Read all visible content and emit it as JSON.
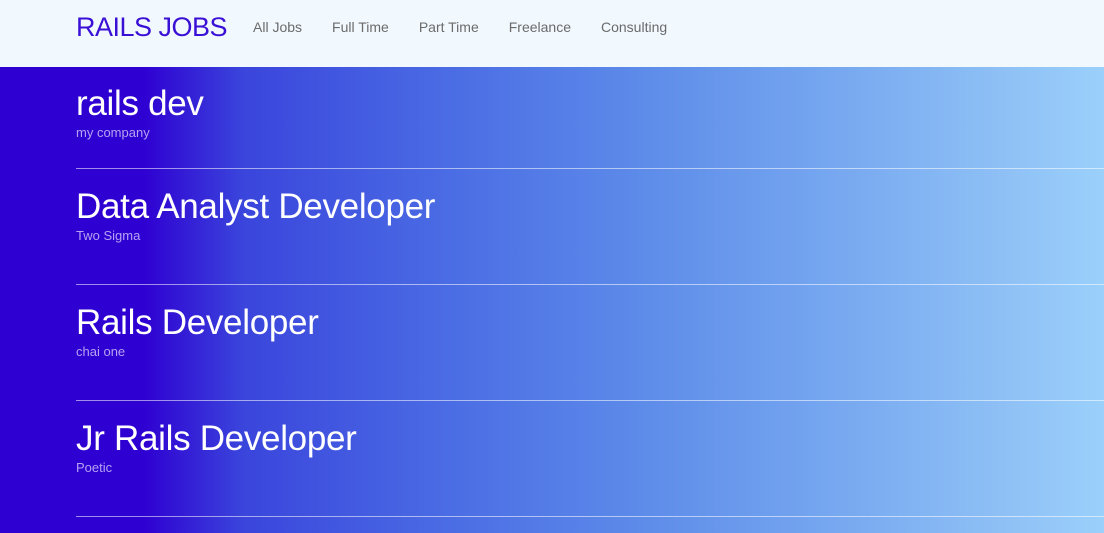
{
  "header": {
    "brand": "RAILS JOBS",
    "nav": [
      {
        "label": "All Jobs"
      },
      {
        "label": "Full Time"
      },
      {
        "label": "Part Time"
      },
      {
        "label": "Freelance"
      },
      {
        "label": "Consulting"
      }
    ]
  },
  "jobs": [
    {
      "title": "rails dev",
      "company": "my company"
    },
    {
      "title": "Data Analyst Developer",
      "company": "Two Sigma"
    },
    {
      "title": "Rails Developer",
      "company": "chai one"
    },
    {
      "title": "Jr Rails Developer",
      "company": "Poetic"
    }
  ],
  "colors": {
    "brand": "#3a10d6",
    "nav_background": "#f1f8fe",
    "gradient_start": "#2f00d2",
    "gradient_end": "#9bd0fb",
    "company_text": "#b6a3f2"
  }
}
